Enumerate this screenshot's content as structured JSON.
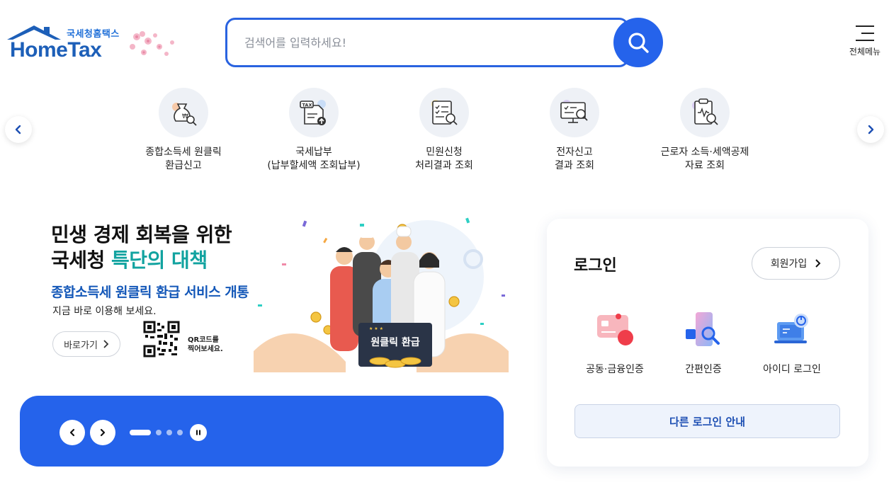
{
  "header": {
    "logo_sub": "국세청홈택스",
    "logo_main": "HomeTax",
    "search_placeholder": "검색어를 입력하세요!",
    "menu_label": "전체메뉴"
  },
  "quick_menu": {
    "items": [
      {
        "line1": "종합소득세 원클릭",
        "line2": "환급신고",
        "icon": "refund-icon"
      },
      {
        "line1": "국세납부",
        "line2": "(납부할세액 조회납부)",
        "icon": "tax-payment-icon"
      },
      {
        "line1": "민원신청",
        "line2": "처리결과 조회",
        "icon": "civil-petition-icon"
      },
      {
        "line1": "전자신고",
        "line2": "결과 조회",
        "icon": "e-filing-icon"
      },
      {
        "line1": "근로자 소득·세액공제",
        "line2": "자료 조회",
        "icon": "deduction-data-icon"
      }
    ]
  },
  "banner": {
    "title_line1": "민생 경제 회복을 위한",
    "title_line2_a": "국세청 ",
    "title_line2_b": "특단의 대책",
    "subtitle": "종합소득세 원클릭 환급 서비스 개통",
    "desc": "지금 바로 이용해 보세요.",
    "go_label": "바로가기",
    "qr_line1": "QR코드를",
    "qr_line2": "찍어보세요.",
    "sign_text": "원클릭 환급",
    "slide_count": 4,
    "active_slide": 1
  },
  "login": {
    "title": "로그인",
    "signup_label": "회원가입",
    "options": [
      {
        "label": "공동·금융인증",
        "icon": "certificate-icon"
      },
      {
        "label": "간편인증",
        "icon": "simple-auth-icon"
      },
      {
        "label": "아이디 로그인",
        "icon": "id-login-icon"
      }
    ],
    "other_login_label": "다른 로그인 안내"
  },
  "colors": {
    "primary": "#2563eb",
    "logo_blue": "#1d5fb8",
    "highlight_teal": "#12a3a0",
    "subtitle_blue": "#1357b8"
  }
}
